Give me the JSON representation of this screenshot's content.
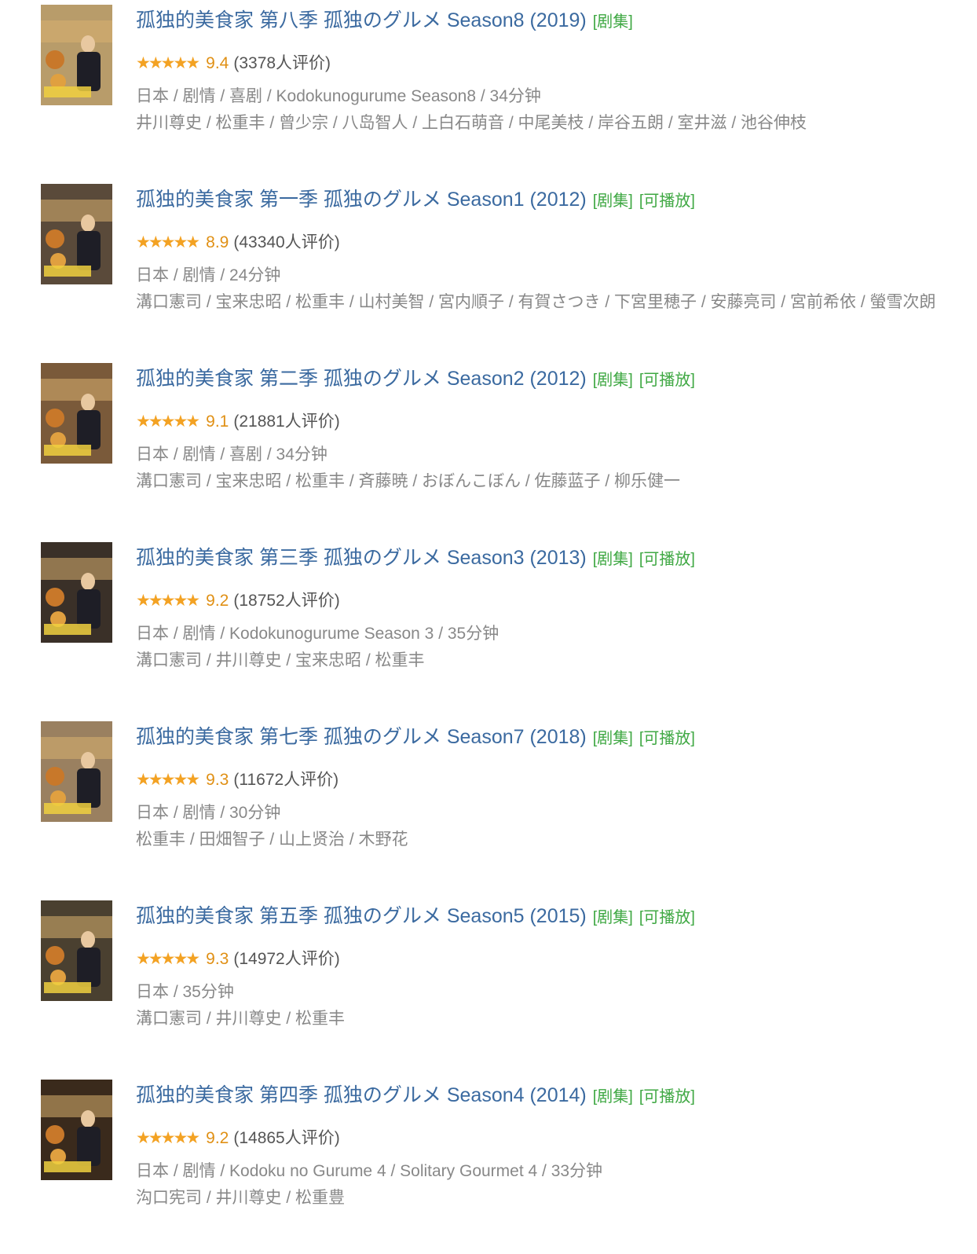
{
  "items": [
    {
      "title": "孤独的美食家 第八季 孤独のグルメ Season8 (2019)",
      "tags": [
        "[剧集]"
      ],
      "stars": "★★★★★",
      "score": "9.4",
      "votes": "(3378人评价)",
      "info": "日本 / 剧情 / 喜剧 / Kodokunogurume Season8 / 34分钟",
      "cast": "井川尊史 / 松重丰 / 曾少宗 / 八岛智人 / 上白石萌音 / 中尾美枝 / 岸谷五朗 / 室井滋 / 池谷伸枝",
      "poster_color": "#b89c6a"
    },
    {
      "title": "孤独的美食家 第一季 孤独のグルメ Season1 (2012)",
      "tags": [
        "[剧集]",
        "[可播放]"
      ],
      "stars": "★★★★★",
      "score": "8.9",
      "votes": "(43340人评价)",
      "info": "日本 / 剧情 / 24分钟",
      "cast": "溝口憲司 / 宝来忠昭 / 松重丰 / 山村美智 / 宮内順子 / 有賀さつき / 下宮里穂子 / 安藤亮司 / 宮前希依 / 螢雪次朗",
      "poster_color": "#5a4a3a"
    },
    {
      "title": "孤独的美食家 第二季 孤独のグルメ Season2 (2012)",
      "tags": [
        "[剧集]",
        "[可播放]"
      ],
      "stars": "★★★★★",
      "score": "9.1",
      "votes": "(21881人评价)",
      "info": "日本 / 剧情 / 喜剧 / 34分钟",
      "cast": "溝口憲司 / 宝来忠昭 / 松重丰 / 斉藤暁 / おぼんこぼん / 佐藤蓝子 / 柳乐健一",
      "poster_color": "#7a5a3a"
    },
    {
      "title": "孤独的美食家 第三季 孤独のグルメ Season3 (2013)",
      "tags": [
        "[剧集]",
        "[可播放]"
      ],
      "stars": "★★★★★",
      "score": "9.2",
      "votes": "(18752人评价)",
      "info": "日本 / 剧情 / Kodokunogurume Season 3 / 35分钟",
      "cast": "溝口憲司 / 井川尊史 / 宝来忠昭 / 松重丰",
      "poster_color": "#3a3028"
    },
    {
      "title": "孤独的美食家 第七季 孤独のグルメ Season7 (2018)",
      "tags": [
        "[剧集]",
        "[可播放]"
      ],
      "stars": "★★★★★",
      "score": "9.3",
      "votes": "(11672人评价)",
      "info": "日本 / 剧情 / 30分钟",
      "cast": "松重丰 / 田畑智子 / 山上贤治 / 木野花",
      "poster_color": "#9a8060"
    },
    {
      "title": "孤独的美食家 第五季 孤独のグルメ Season5 (2015)",
      "tags": [
        "[剧集]",
        "[可播放]"
      ],
      "stars": "★★★★★",
      "score": "9.3",
      "votes": "(14972人评价)",
      "info": "日本 / 35分钟",
      "cast": "溝口憲司 / 井川尊史 / 松重丰",
      "poster_color": "#4a4030"
    },
    {
      "title": "孤独的美食家 第四季 孤独のグルメ Season4 (2014)",
      "tags": [
        "[剧集]",
        "[可播放]"
      ],
      "stars": "★★★★★",
      "score": "9.2",
      "votes": "(14865人评价)",
      "info": "日本 / 剧情 / Kodoku no Gurume 4 / Solitary Gourmet 4 / 33分钟",
      "cast": "沟口宪司 / 井川尊史 / 松重豊",
      "poster_color": "#3a2a1c"
    }
  ]
}
